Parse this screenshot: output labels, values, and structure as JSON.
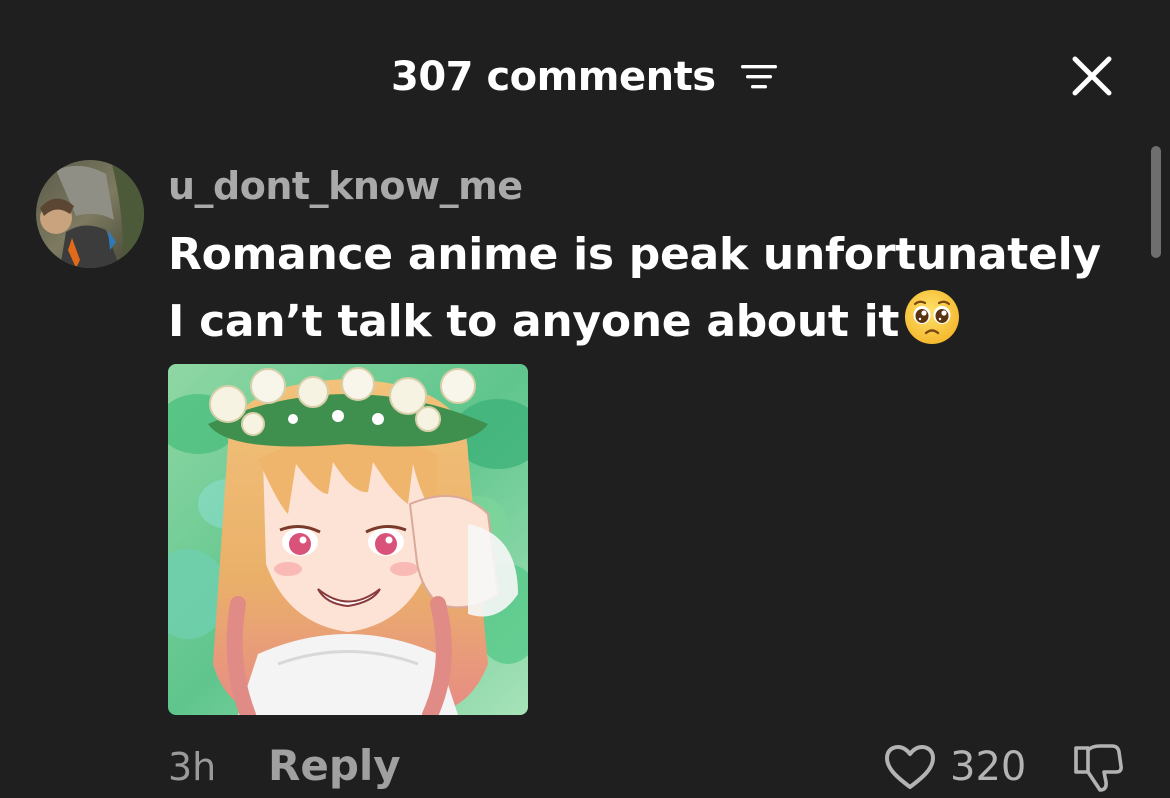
{
  "header": {
    "title": "307 comments",
    "sort_icon": "sort-lines-icon",
    "close_icon": "close-x-icon"
  },
  "comment": {
    "username": "u_dont_know_me",
    "text": "Romance anime is peak unfortunately I can’t talk to anyone about it",
    "emoji": "pleading-face-emoji",
    "time": "3h",
    "reply_label": "Reply",
    "like_count": "320",
    "like_icon": "heart-outline-icon",
    "dislike_icon": "thumbs-down-icon",
    "image_description": "anime girl illustration with flower crown"
  },
  "colors": {
    "background": "#1f1f1f",
    "text_primary": "#ffffff",
    "text_secondary": "#a9a9a9"
  }
}
